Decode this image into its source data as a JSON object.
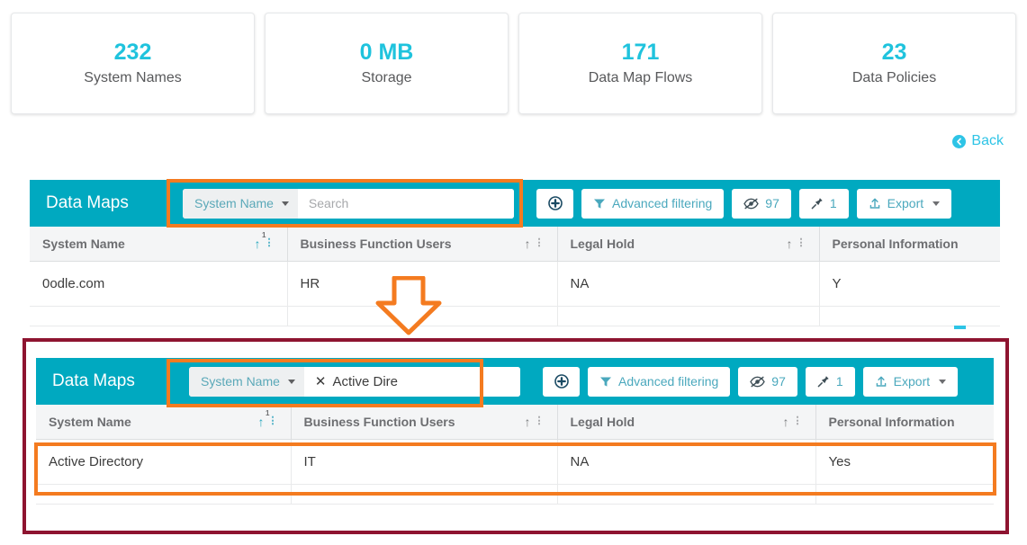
{
  "stats": [
    {
      "value": "232",
      "label": "System Names"
    },
    {
      "value": "0 MB",
      "label": "Storage"
    },
    {
      "value": "171",
      "label": "Data Map Flows"
    },
    {
      "value": "23",
      "label": "Data Policies"
    }
  ],
  "back": {
    "label": "Back",
    "icon": "back-circle-icon"
  },
  "colors": {
    "accent_teal": "#00a9c0",
    "value_cyan": "#1fc3dd",
    "annotation_orange": "#f47b20",
    "frame_maroon": "#8e1430",
    "header_gray": "#f4f5f6"
  },
  "panels": [
    {
      "id": "before",
      "title": "Data Maps",
      "search": {
        "field_label": "System Name",
        "placeholder": "Search",
        "value": "",
        "has_clear": false
      },
      "buttons": {
        "add_label": "",
        "advanced_filtering_label": "Advanced filtering",
        "hidden_columns_count": "97",
        "pinned_count": "1",
        "export_label": "Export"
      },
      "columns": [
        {
          "label": "System Name",
          "sorted": true,
          "sort_index": "1",
          "has_sort": true
        },
        {
          "label": "Business Function Users",
          "sorted": false,
          "sort_index": "",
          "has_sort": true
        },
        {
          "label": "Legal Hold",
          "sorted": false,
          "sort_index": "",
          "has_sort": true
        },
        {
          "label": "Personal Information",
          "sorted": false,
          "sort_index": "",
          "has_sort": false
        }
      ],
      "rows": [
        [
          "0odle.com",
          "HR",
          "NA",
          "Y"
        ]
      ]
    },
    {
      "id": "after",
      "title": "Data Maps",
      "search": {
        "field_label": "System Name",
        "placeholder": "Search",
        "value": "Active Dire",
        "has_clear": true
      },
      "buttons": {
        "add_label": "",
        "advanced_filtering_label": "Advanced filtering",
        "hidden_columns_count": "97",
        "pinned_count": "1",
        "export_label": "Export"
      },
      "columns": [
        {
          "label": "System Name",
          "sorted": true,
          "sort_index": "1",
          "has_sort": true
        },
        {
          "label": "Business Function Users",
          "sorted": false,
          "sort_index": "",
          "has_sort": true
        },
        {
          "label": "Legal Hold",
          "sorted": false,
          "sort_index": "",
          "has_sort": true
        },
        {
          "label": "Personal Information",
          "sorted": false,
          "sort_index": "",
          "has_sort": false
        }
      ],
      "rows": [
        [
          "Active Directory",
          "IT",
          "NA",
          "Yes"
        ]
      ]
    }
  ]
}
